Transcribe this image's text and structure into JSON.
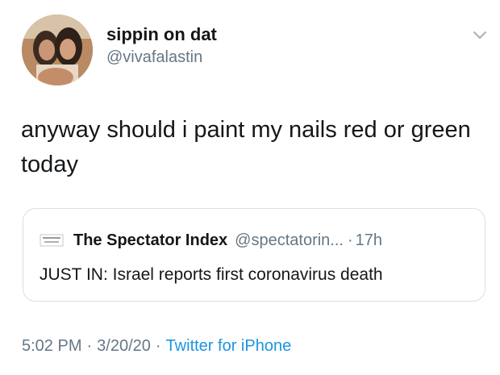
{
  "author": {
    "display_name": "sippin on dat",
    "handle": "@vivafalastin",
    "avatar_icon": "profile-photo"
  },
  "menu_icon": "chevron-down-icon",
  "tweet": {
    "text": "anyway should i paint my nails red or green today"
  },
  "quoted_tweet": {
    "avatar_icon": "spectator-index-logo",
    "display_name": "The Spectator Index",
    "handle": "@spectatorin...",
    "separator": "·",
    "time": "17h",
    "text": "JUST IN: Israel reports first coronavirus death"
  },
  "meta": {
    "time": "5:02 PM",
    "separator": "·",
    "date": "3/20/20",
    "separator2": "·",
    "source": "Twitter for iPhone"
  },
  "colors": {
    "text_primary": "#14171a",
    "text_secondary": "#657786",
    "link": "#1b95e0",
    "border": "#d8dfe4"
  }
}
